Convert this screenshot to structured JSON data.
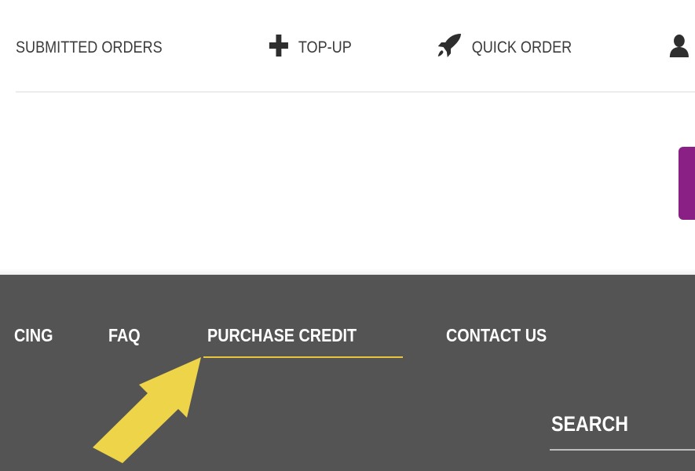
{
  "top_nav": {
    "submitted_orders": "SUBMITTED ORDERS",
    "top_up": "TOP-UP",
    "quick_order": "QUICK ORDER",
    "icons": {
      "top_up": "plus-icon",
      "quick_order": "rocket-icon",
      "account": "user-icon"
    }
  },
  "footer": {
    "links": {
      "pricing": "CING",
      "faq": "FAQ",
      "purchase_credit": "PURCHASE CREDIT",
      "contact_us": "CONTACT US"
    },
    "search_label": "SEARCH"
  },
  "colors": {
    "footer_background": "#545454",
    "accent_underline": "#e8c53c",
    "arrow": "#eed448",
    "side_tab": "#8a1f86"
  }
}
